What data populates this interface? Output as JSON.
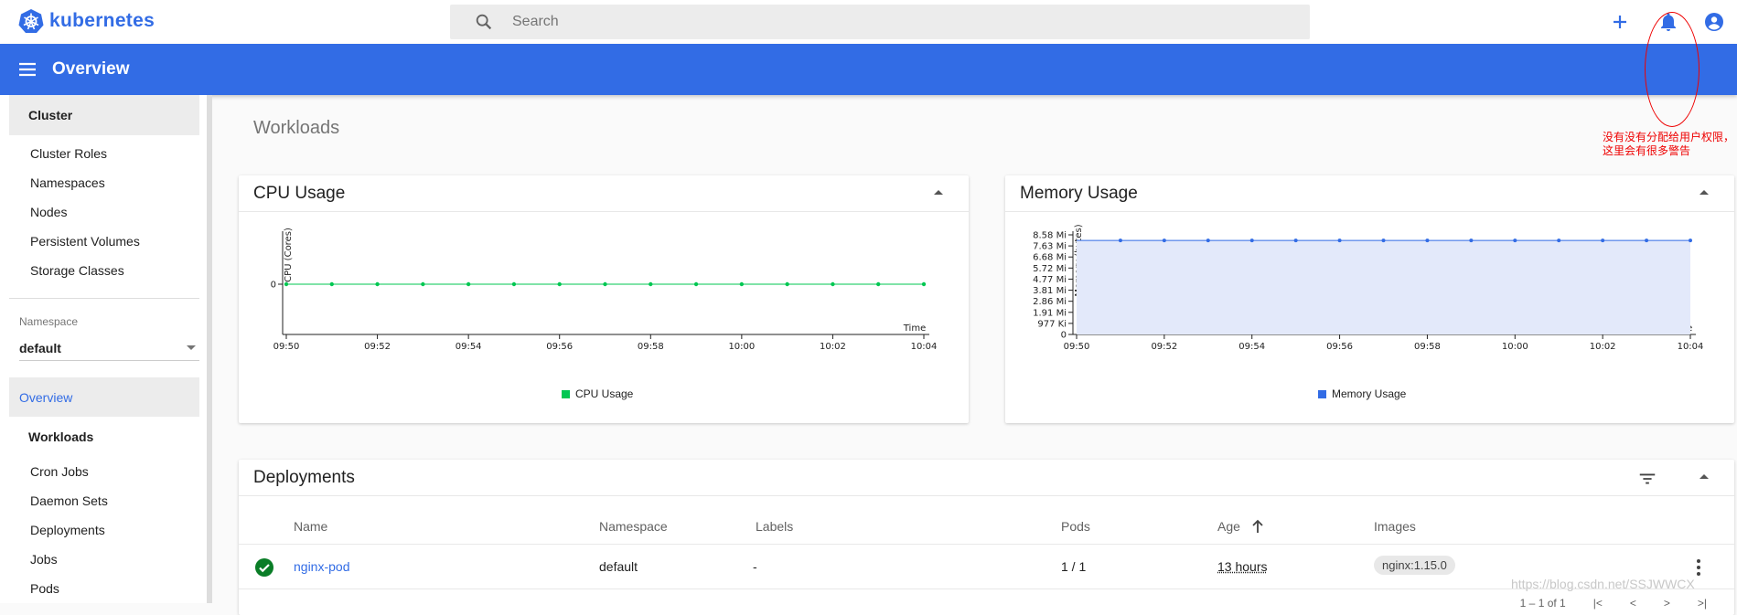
{
  "app": {
    "brand": "kubernetes",
    "page_title": "Overview",
    "accent": "#326ce5"
  },
  "search": {
    "placeholder": "Search"
  },
  "sidebar": {
    "cluster_header": "Cluster",
    "cluster_items": [
      "Cluster Roles",
      "Namespaces",
      "Nodes",
      "Persistent Volumes",
      "Storage Classes"
    ],
    "namespace_label": "Namespace",
    "namespace_value": "default",
    "overview": "Overview",
    "workloads_header": "Workloads",
    "workload_items": [
      "Cron Jobs",
      "Daemon Sets",
      "Deployments",
      "Jobs",
      "Pods"
    ]
  },
  "main": {
    "section_title": "Workloads"
  },
  "cpu_card": {
    "title": "CPU Usage",
    "legend": "CPU Usage",
    "ylabel": "CPU (Cores)",
    "xlabel": "Time"
  },
  "mem_card": {
    "title": "Memory Usage",
    "legend": "Memory Usage",
    "ylabel": "Memory (bytes)",
    "xlabel": "Time"
  },
  "chart_data": [
    {
      "type": "line",
      "title": "CPU Usage",
      "xlabel": "Time",
      "ylabel": "CPU (Cores)",
      "x": [
        "09:50",
        "09:51",
        "09:52",
        "09:53",
        "09:54",
        "09:55",
        "09:56",
        "09:57",
        "09:58",
        "09:59",
        "10:00",
        "10:01",
        "10:02",
        "10:03",
        "10:04"
      ],
      "x_tick_labels": [
        "09:50",
        "09:52",
        "09:54",
        "09:56",
        "09:58",
        "10:00",
        "10:02",
        "10:04"
      ],
      "y_tick_labels": [
        "0"
      ],
      "series": [
        {
          "name": "CPU Usage",
          "color": "#00c752",
          "values": [
            0,
            0,
            0,
            0,
            0,
            0,
            0,
            0,
            0,
            0,
            0,
            0,
            0,
            0,
            0
          ]
        }
      ]
    },
    {
      "type": "area",
      "title": "Memory Usage",
      "xlabel": "Time",
      "ylabel": "Memory (bytes)",
      "x": [
        "09:50",
        "09:51",
        "09:52",
        "09:53",
        "09:54",
        "09:55",
        "09:56",
        "09:57",
        "09:58",
        "09:59",
        "10:00",
        "10:01",
        "10:02",
        "10:03",
        "10:04"
      ],
      "x_tick_labels": [
        "09:50",
        "09:52",
        "09:54",
        "09:56",
        "09:58",
        "10:00",
        "10:02",
        "10:04"
      ],
      "y_tick_labels": [
        "0",
        "977 Ki",
        "1.91 Mi",
        "2.86 Mi",
        "3.81 Mi",
        "4.77 Mi",
        "5.72 Mi",
        "6.68 Mi",
        "7.63 Mi",
        "8.58 Mi"
      ],
      "y_max_mi": 9.0,
      "series": [
        {
          "name": "Memory Usage",
          "color": "#326ce5",
          "values_mi": [
            8.1,
            8.1,
            8.1,
            8.1,
            8.1,
            8.1,
            8.1,
            8.1,
            8.1,
            8.1,
            8.1,
            8.1,
            8.1,
            8.1,
            8.1
          ]
        }
      ]
    }
  ],
  "deployments": {
    "title": "Deployments",
    "columns": [
      "Name",
      "Namespace",
      "Labels",
      "Pods",
      "Age",
      "Images"
    ],
    "rows": [
      {
        "name": "nginx-pod",
        "namespace": "default",
        "labels": "-",
        "pods": "1 / 1",
        "age": "13 hours",
        "image": "nginx:1.15.0"
      }
    ],
    "pagination": "1 – 1 of 1"
  },
  "annotation": {
    "text": "没有没有分配给用户权限，\n这里会有很多警告",
    "color": "#e00000"
  },
  "watermark": "https://blog.csdn.net/SSJWWCX"
}
